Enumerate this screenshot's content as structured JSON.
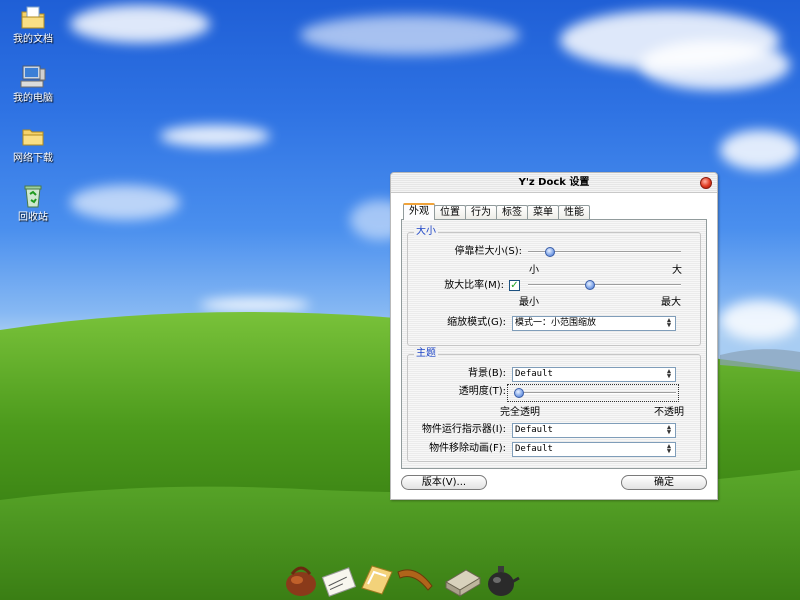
{
  "desktop": {
    "icons": [
      {
        "label": "我的文档",
        "icon": "my-documents-icon"
      },
      {
        "label": "我的电脑",
        "icon": "my-computer-icon"
      },
      {
        "label": "网络下载",
        "icon": "folder-icon"
      },
      {
        "label": "回收站",
        "icon": "recycle-bin-icon"
      }
    ]
  },
  "dialog": {
    "title": "Y'z Dock 设置",
    "tabs": [
      "外观",
      "位置",
      "行为",
      "标签",
      "菜单",
      "性能"
    ],
    "active_tab": "外观",
    "size_group": {
      "title": "大小",
      "dock_size_label": "停靠栏大小(S):",
      "dock_size_value": 0.12,
      "dock_size_min": "小",
      "dock_size_max": "大",
      "zoom_ratio_label": "放大比率(M):",
      "zoom_enabled": true,
      "zoom_value": 0.4,
      "zoom_min": "最小",
      "zoom_max": "最大",
      "zoom_mode_label": "缩放模式(G):",
      "zoom_mode_value": "模式一：小范围缩放"
    },
    "theme_group": {
      "title": "主题",
      "background_label": "背景(B):",
      "background_value": "Default",
      "opacity_label": "透明度(T):",
      "opacity_value": 0.0,
      "opacity_min": "完全透明",
      "opacity_max": "不透明",
      "indicator_label": "物件运行指示器(I):",
      "indicator_value": "Default",
      "remove_anim_label": "物件移除动画(F):",
      "remove_anim_value": "Default"
    },
    "version_button": "版本(V)...",
    "ok_button": "确定"
  },
  "dock": {
    "items": [
      "bag-icon",
      "envelope-icon",
      "notes-icon",
      "comb-icon",
      "book-icon",
      "teapot-icon"
    ]
  },
  "colors": {
    "sky": "#2e72e3",
    "grass": "#4c9a1c",
    "group_title": "#1c44c6",
    "active_tab_accent": "#f0a33a"
  }
}
